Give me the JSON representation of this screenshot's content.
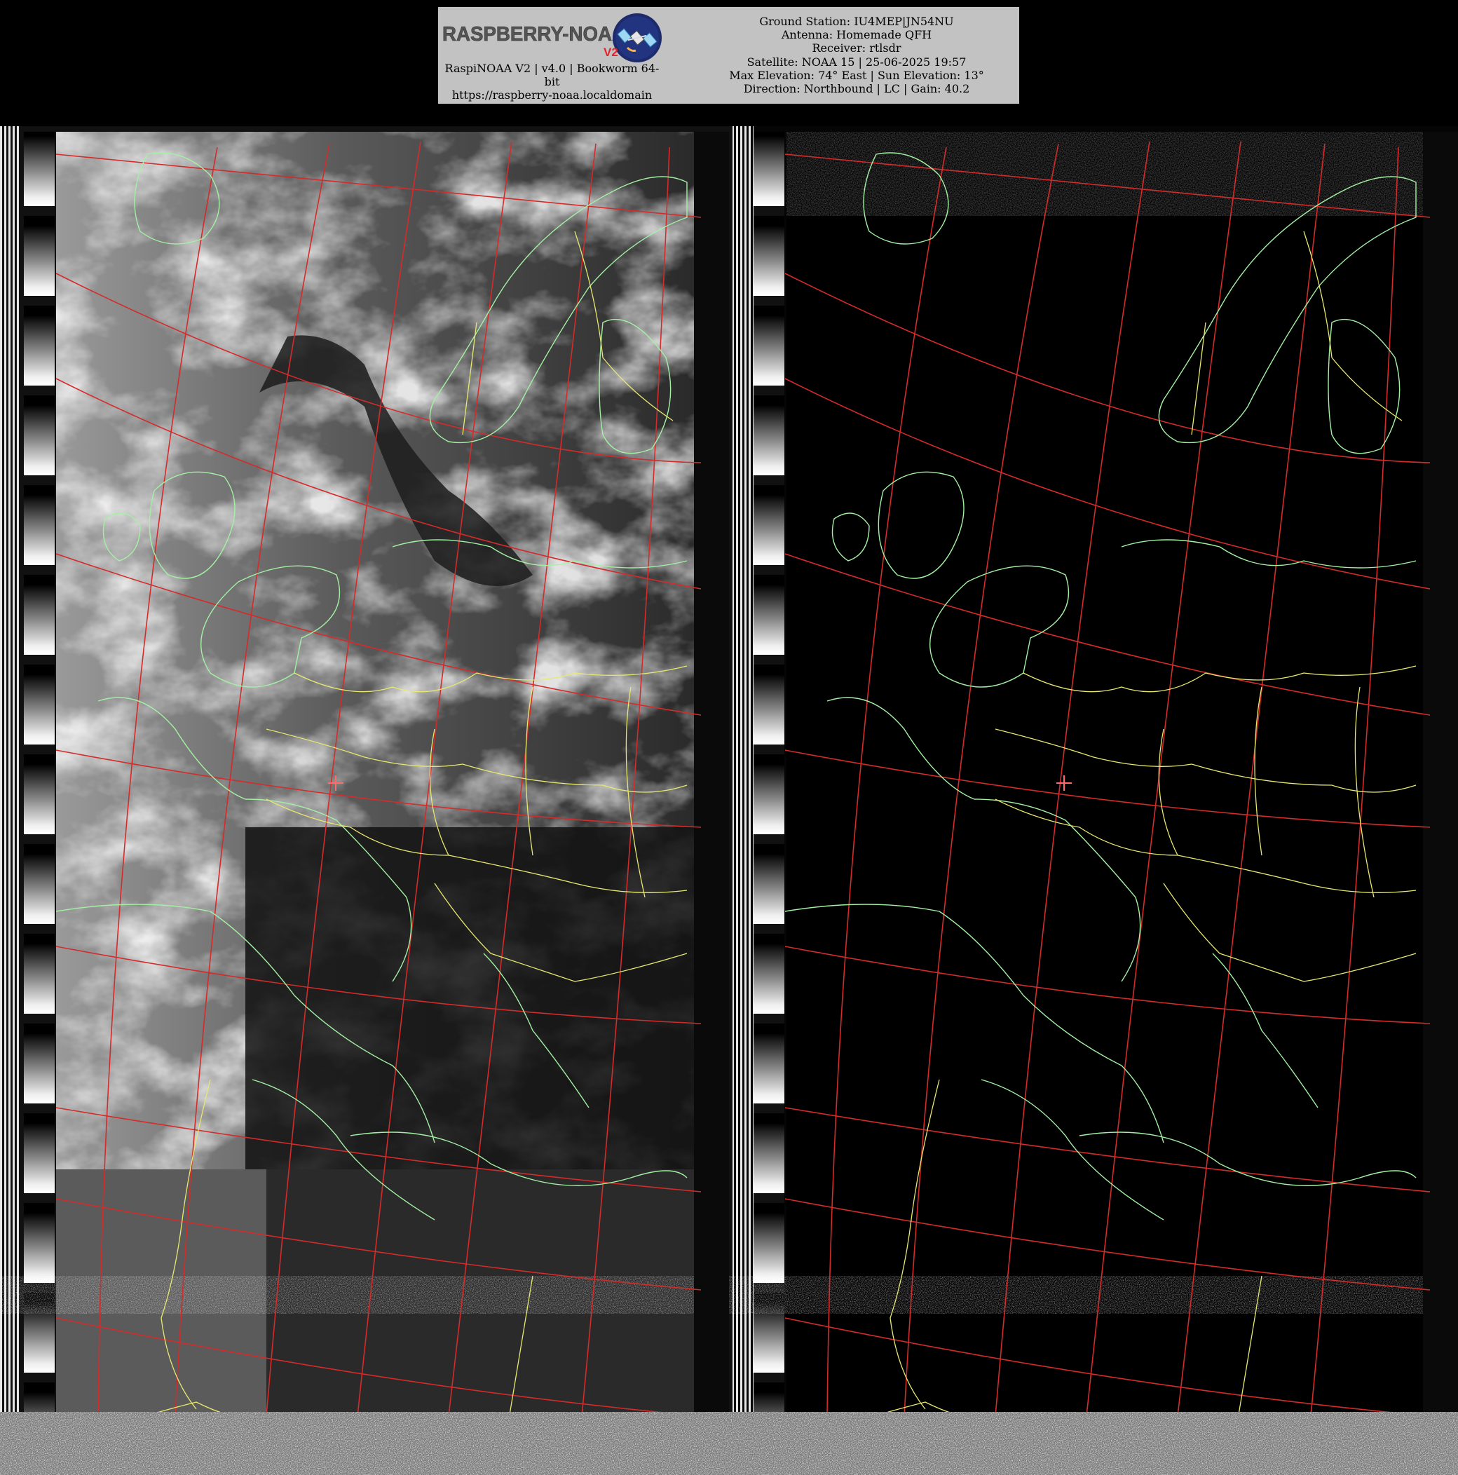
{
  "header": {
    "logo": {
      "wordmark": "RASPBERRY-NOAA",
      "badge": "V2",
      "icon": "satellite-icon",
      "colors": {
        "wordmark": "#555555",
        "badge": "#e8202a",
        "disc": "#1d2a6b",
        "satellite": "#9fd7f2"
      }
    },
    "software_line1": "RaspiNOAA V2 | v4.0 | Bookworm 64-",
    "software_line2": "bit",
    "url": "https://raspberry-noaa.localdomain",
    "station_lines": [
      "Ground Station: IU4MEP|JN54NU",
      "Antenna: Homemade QFH",
      "Receiver: rtlsdr",
      "Satellite: NOAA 15 | 25-06-2025 19:57",
      "Max Elevation: 74° East | Sun Elevation: 13°",
      "Direction: Northbound | LC | Gain: 40.2"
    ]
  },
  "imagery": {
    "channels": 2,
    "overlays": {
      "coastline_color": "#a3f0a3",
      "border_color": "#e8e870",
      "graticule_color": "#d42b2b",
      "station_marker": "plus-icon",
      "marker_color": "#ff6a6a"
    }
  }
}
